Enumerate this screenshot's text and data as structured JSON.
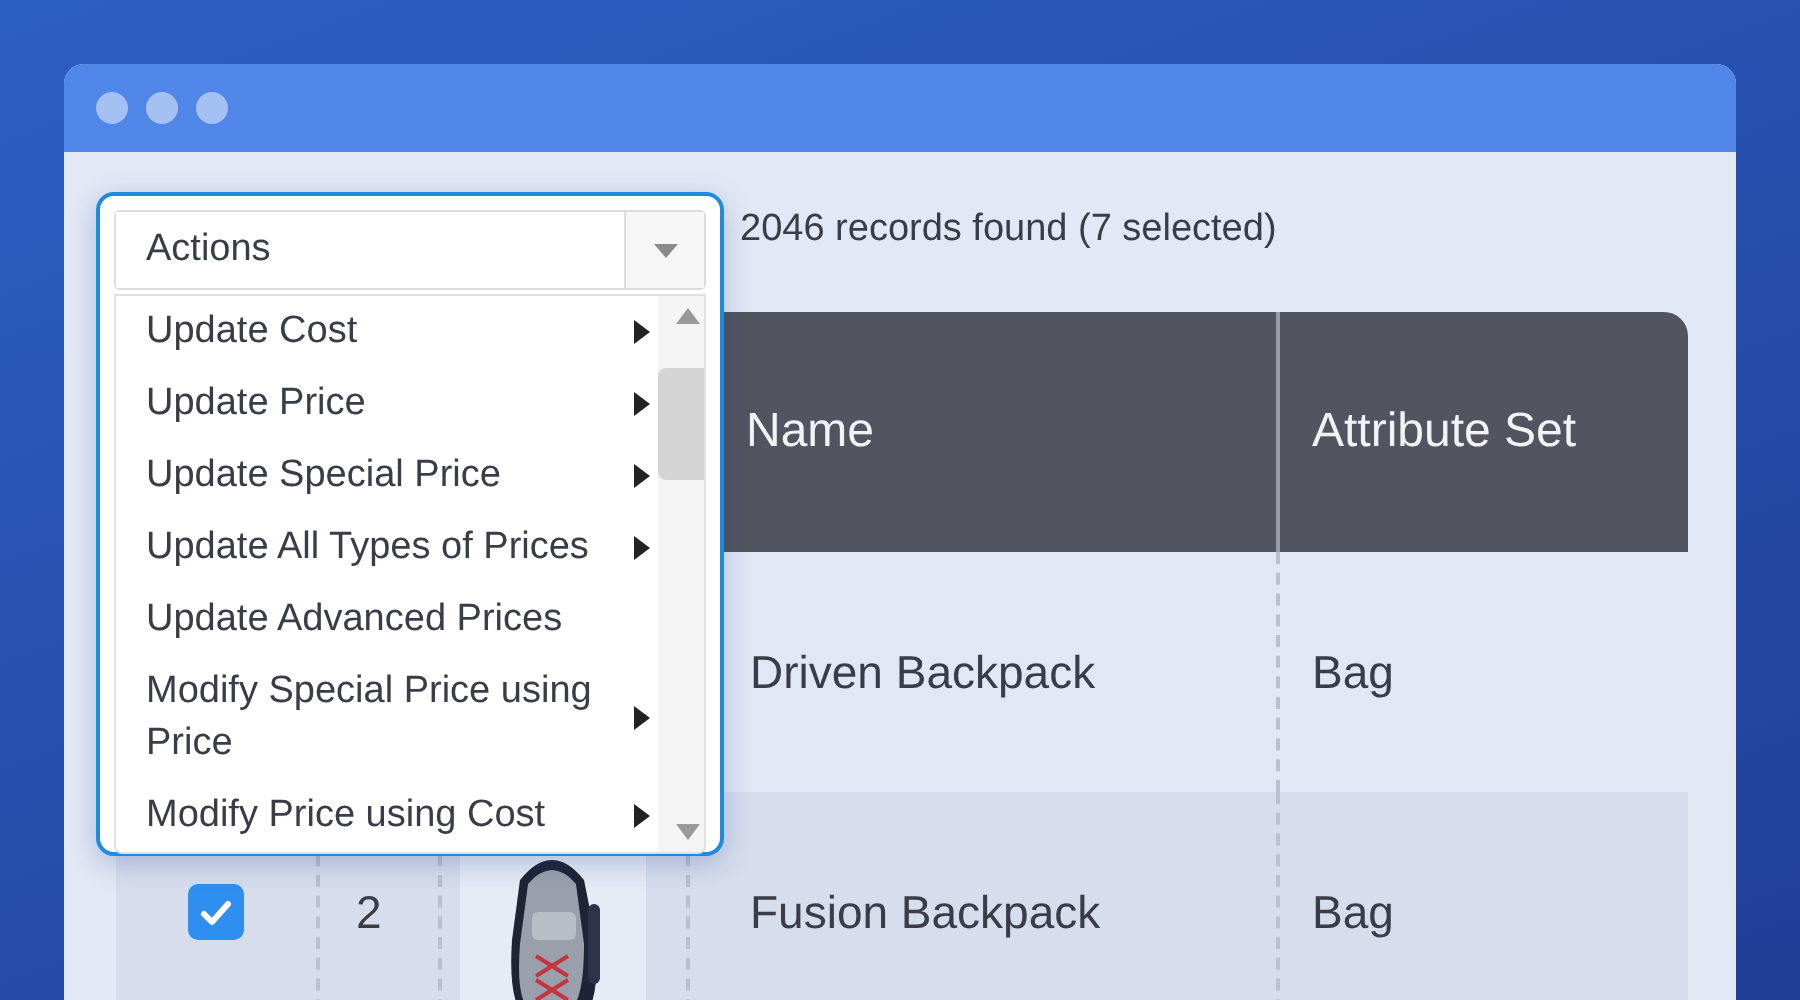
{
  "actions_menu": {
    "label": "Actions",
    "expanded": true,
    "items": [
      {
        "label": "Update Cost",
        "submenu": true
      },
      {
        "label": "Update Price",
        "submenu": true
      },
      {
        "label": "Update Special Price",
        "submenu": true
      },
      {
        "label": "Update All Types of Prices",
        "submenu": true
      },
      {
        "label": "Update Advanced Prices",
        "submenu": false
      },
      {
        "label": "Modify Special Price using Price",
        "submenu": true
      },
      {
        "label": "Modify Price using Cost",
        "submenu": true
      }
    ]
  },
  "records_summary": "2046 records found (7 selected)",
  "table": {
    "columns": [
      "Name",
      "Attribute Set"
    ],
    "rows": [
      {
        "name": "Driven Backpack",
        "attribute_set": "Bag"
      },
      {
        "selected": true,
        "id": "2",
        "name": "Fusion Backpack",
        "attribute_set": "Bag"
      }
    ]
  }
}
